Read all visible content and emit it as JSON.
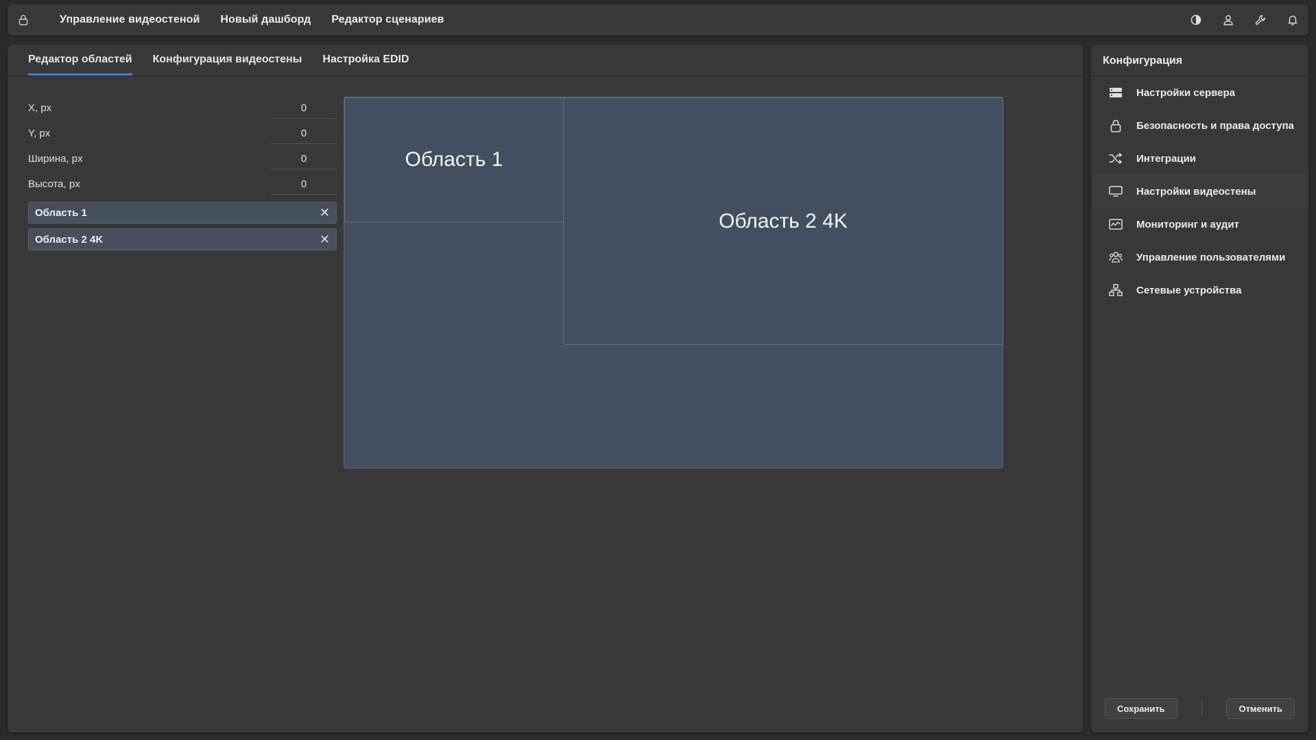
{
  "topbar": {
    "nav": [
      "Управление видеостеной",
      "Новый дашборд",
      "Редактор сценариев"
    ],
    "icons": [
      "lock-icon",
      "contrast-icon",
      "user-icon",
      "wrench-icon",
      "bell-icon"
    ]
  },
  "tabs": [
    {
      "label": "Редактор областей",
      "active": true
    },
    {
      "label": "Конфигурация видеостены",
      "active": false
    },
    {
      "label": "Настройка EDID",
      "active": false
    }
  ],
  "props": [
    {
      "label": "X, px",
      "value": "0"
    },
    {
      "label": "Y, px",
      "value": "0"
    },
    {
      "label": "Ширина, px",
      "value": "0"
    },
    {
      "label": "Высота, px",
      "value": "0"
    }
  ],
  "regions_list": [
    {
      "label": "Область 1",
      "close": "✕"
    },
    {
      "label": "Область 2 4K",
      "close": "✕"
    }
  ],
  "canvas": {
    "regions": [
      {
        "label": "Область 1"
      },
      {
        "label": "Область 2 4K"
      }
    ]
  },
  "sidebar": {
    "title": "Конфигурация",
    "items": [
      {
        "label": "Настройки сервера",
        "icon": "server-icon"
      },
      {
        "label": "Безопасность и права доступа",
        "icon": "lock-icon"
      },
      {
        "label": "Интеграции",
        "icon": "shuffle-icon"
      },
      {
        "label": "Настройки видеостены",
        "icon": "monitor-icon",
        "active": true
      },
      {
        "label": "Мониторинг и аудит",
        "icon": "activity-icon"
      },
      {
        "label": "Управление пользователями",
        "icon": "users-icon"
      },
      {
        "label": "Сетевые устройства",
        "icon": "network-icon"
      }
    ],
    "save_label": "Сохранить",
    "cancel_label": "Отменить"
  },
  "colors": {
    "accent": "#3f87d6",
    "region_fill": "#434f60",
    "panel": "#383838",
    "background": "#2b2b2b"
  }
}
